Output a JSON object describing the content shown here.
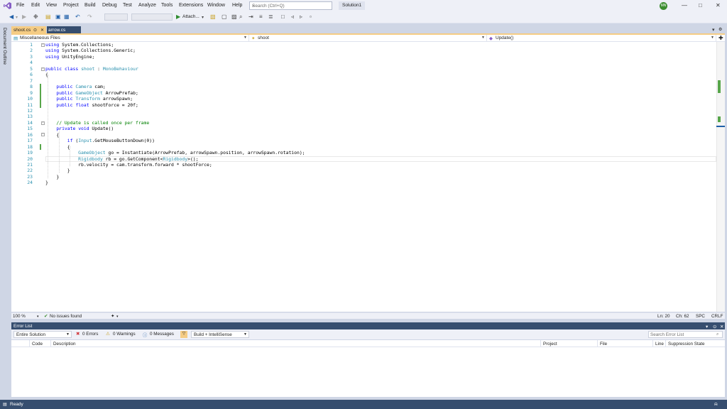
{
  "menu": {
    "items": [
      "File",
      "Edit",
      "View",
      "Project",
      "Build",
      "Debug",
      "Test",
      "Analyze",
      "Tools",
      "Extensions",
      "Window",
      "Help"
    ],
    "search_placeholder": "Search (Ctrl+Q)",
    "solution_name": "Solution1",
    "user_initials": "MN"
  },
  "toolbar": {
    "attach_label": "Attach..."
  },
  "side": {
    "document_outline": "Document Outline"
  },
  "tabs": [
    {
      "label": "shoot.cs",
      "active": true
    },
    {
      "label": "arrow.cs",
      "active": false
    }
  ],
  "navbar": {
    "project": "Miscellaneous Files",
    "type": "shoot",
    "member": "Update()"
  },
  "code": {
    "lines": [
      "using System.Collections;",
      "using System.Collections.Generic;",
      "using UnityEngine;",
      "",
      "public class shoot : MonoBehaviour",
      "{",
      "",
      "    public Camera cam;",
      "    public GameObject ArrowPrefab;",
      "    public Transform arrowSpawn;",
      "    public float shootForce = 20f;",
      "",
      "",
      "    // Update is called once per frame",
      "    private void Update()",
      "    {",
      "        if (Input.GetMouseButtonDown(0))",
      "        {",
      "            GameObject go = Instantiate(ArrowPrefab, arrowSpawn.position, arrowSpawn.rotation);",
      "            Rigidbody rb = go.GetComponent<Rigidbody>();",
      "            rb.velocity = cam.transform.forward * shootForce;",
      "        }",
      "    }",
      "}",
      ""
    ]
  },
  "editor_status": {
    "zoom": "100 %",
    "issues": "No issues found",
    "line": "Ln: 20",
    "col": "Ch: 62",
    "whitespace": "SPC",
    "line_ending": "CRLF"
  },
  "error_list": {
    "title": "Error List",
    "scope": "Entire Solution",
    "errors": "0 Errors",
    "warnings": "0 Warnings",
    "messages": "0 Messages",
    "build_filter": "Build + IntelliSense",
    "search_placeholder": "Search Error List",
    "columns": [
      "Code",
      "Description",
      "Project",
      "File",
      "Line",
      "Suppression State"
    ]
  },
  "statusbar": {
    "text": "Ready"
  },
  "colors": {
    "accent": "#364e6f",
    "active_tab": "#f5cc84",
    "keyword": "#0000ff",
    "type": "#2b91af",
    "comment": "#008000",
    "change_marker": "#57a64a"
  }
}
